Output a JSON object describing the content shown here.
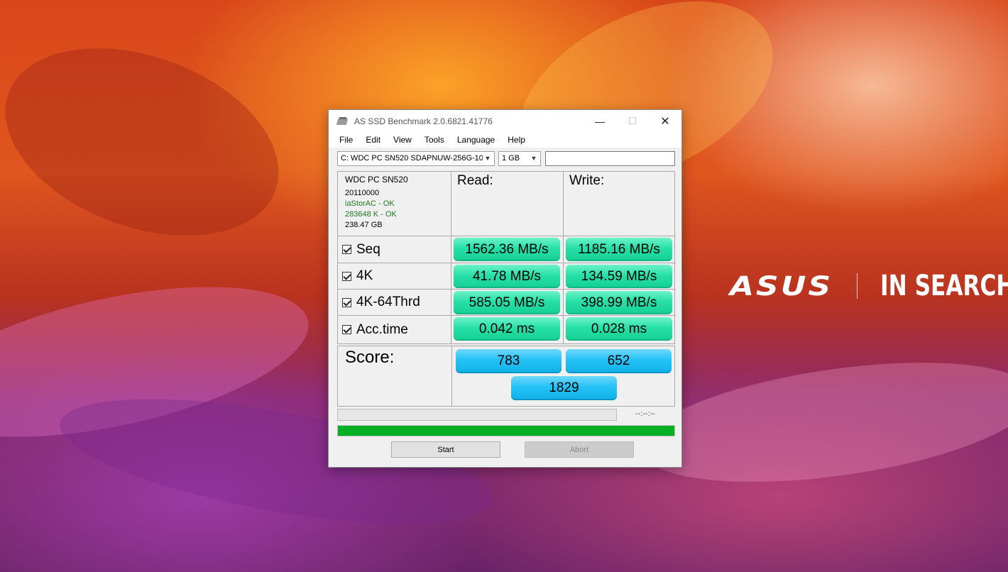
{
  "desktop": {
    "brand_logo": "ASUS",
    "brand_tagline": "IN SEARCH"
  },
  "window": {
    "title": "AS SSD Benchmark 2.0.6821.41776",
    "controls": {
      "minimize": "—",
      "maximize": "☐",
      "close": "✕"
    }
  },
  "menu": [
    "File",
    "Edit",
    "View",
    "Tools",
    "Language",
    "Help"
  ],
  "toolbar": {
    "drive_select": "C: WDC PC SN520 SDAPNUW-256G-10",
    "size_select": "1 GB",
    "blank_input": ""
  },
  "drive_info": {
    "name": "WDC PC SN520",
    "firmware": "20110000",
    "driver": "iaStorAC - OK",
    "alignment": "283648 K - OK",
    "capacity": "238.47 GB"
  },
  "headers": {
    "read": "Read:",
    "write": "Write:"
  },
  "tests": [
    {
      "label": "Seq",
      "checked": true,
      "read": "1562.36 MB/s",
      "write": "1185.16 MB/s"
    },
    {
      "label": "4K",
      "checked": true,
      "read": "41.78 MB/s",
      "write": "134.59 MB/s"
    },
    {
      "label": "4K-64Thrd",
      "checked": true,
      "read": "585.05 MB/s",
      "write": "398.99 MB/s"
    },
    {
      "label": "Acc.time",
      "checked": true,
      "read": "0.042 ms",
      "write": "0.028 ms"
    }
  ],
  "score": {
    "label": "Score:",
    "read": "783",
    "write": "652",
    "total": "1829"
  },
  "progress": {
    "time": "--:--:--",
    "test_progress_fraction": 0.0,
    "overall_progress_fraction": 1.0
  },
  "buttons": {
    "start": "Start",
    "abort": "Abort"
  },
  "colors": {
    "result_green": "#27e0a7",
    "score_blue": "#24c2f5",
    "progress_green": "#06b025",
    "ok_text": "#1e7a1e"
  }
}
